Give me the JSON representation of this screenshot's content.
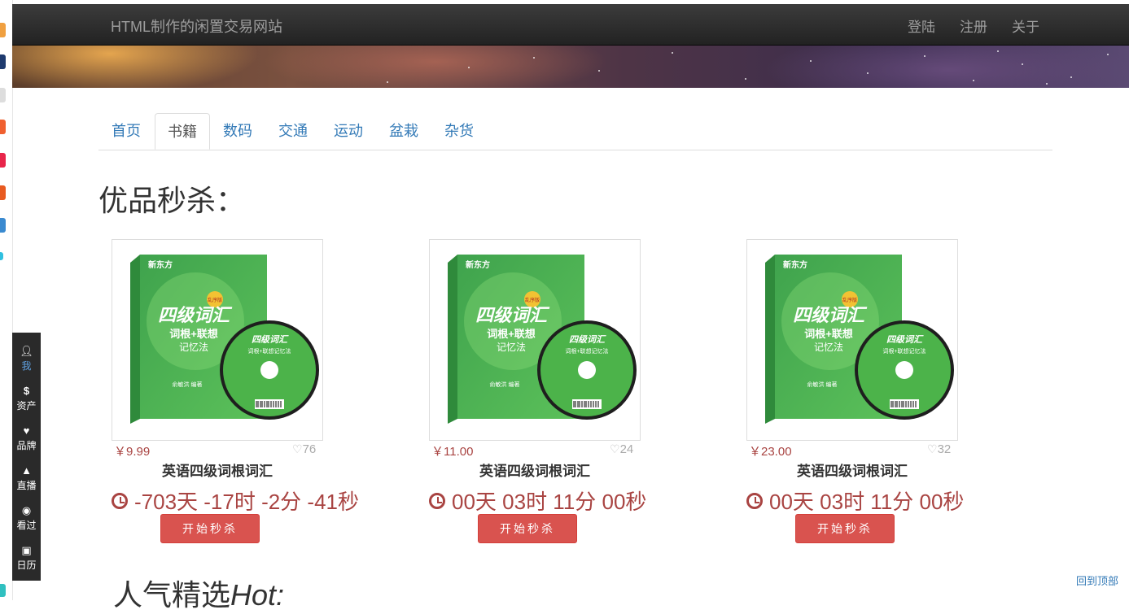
{
  "navbar": {
    "brand": "HTML制作的闲置交易网站",
    "links": [
      "登陆",
      "注册",
      "关于"
    ]
  },
  "tabs": [
    "首页",
    "书籍",
    "数码",
    "交通",
    "运动",
    "盆栽",
    "杂货"
  ],
  "active_tab": "书籍",
  "section_title": "优品秒杀：",
  "products": [
    {
      "price": "￥9.99",
      "likes": "76",
      "name": "英语四级词根词汇",
      "countdown": "-703天 -17时 -2分 -41秒",
      "button": "开始秒杀"
    },
    {
      "price": "￥11.00",
      "likes": "24",
      "name": "英语四级词根词汇",
      "countdown": "00天 03时 11分 00秒",
      "button": "开始秒杀"
    },
    {
      "price": "￥23.00",
      "likes": "32",
      "name": "英语四级词根词汇",
      "countdown": "00天 03时 11分 00秒",
      "button": "开始秒杀"
    }
  ],
  "book_cover": {
    "brand_logo": "新东方",
    "badge": "乱序版",
    "title": "四级词汇",
    "subtitle1": "词根+联想",
    "subtitle2": "记忆法",
    "author": "俞敏洪 编著",
    "disc_title": "四级词汇",
    "disc_subtitle": "词根+联想记忆法"
  },
  "hot_title": {
    "zh": "人气精选",
    "en": "Hot:"
  },
  "dock": [
    {
      "icon": "user-icon",
      "label": "我"
    },
    {
      "icon": "dollar-icon",
      "label": "资产"
    },
    {
      "icon": "heart-icon",
      "label": "品牌"
    },
    {
      "icon": "bell-icon",
      "label": "直播"
    },
    {
      "icon": "eye-icon",
      "label": "看过"
    },
    {
      "icon": "calendar-icon",
      "label": "日历"
    }
  ],
  "back_to_top": "回到顶部",
  "colors": {
    "accent": "#337ab7",
    "danger": "#d9534f",
    "price": "#a94442",
    "navbar": "#222222"
  }
}
